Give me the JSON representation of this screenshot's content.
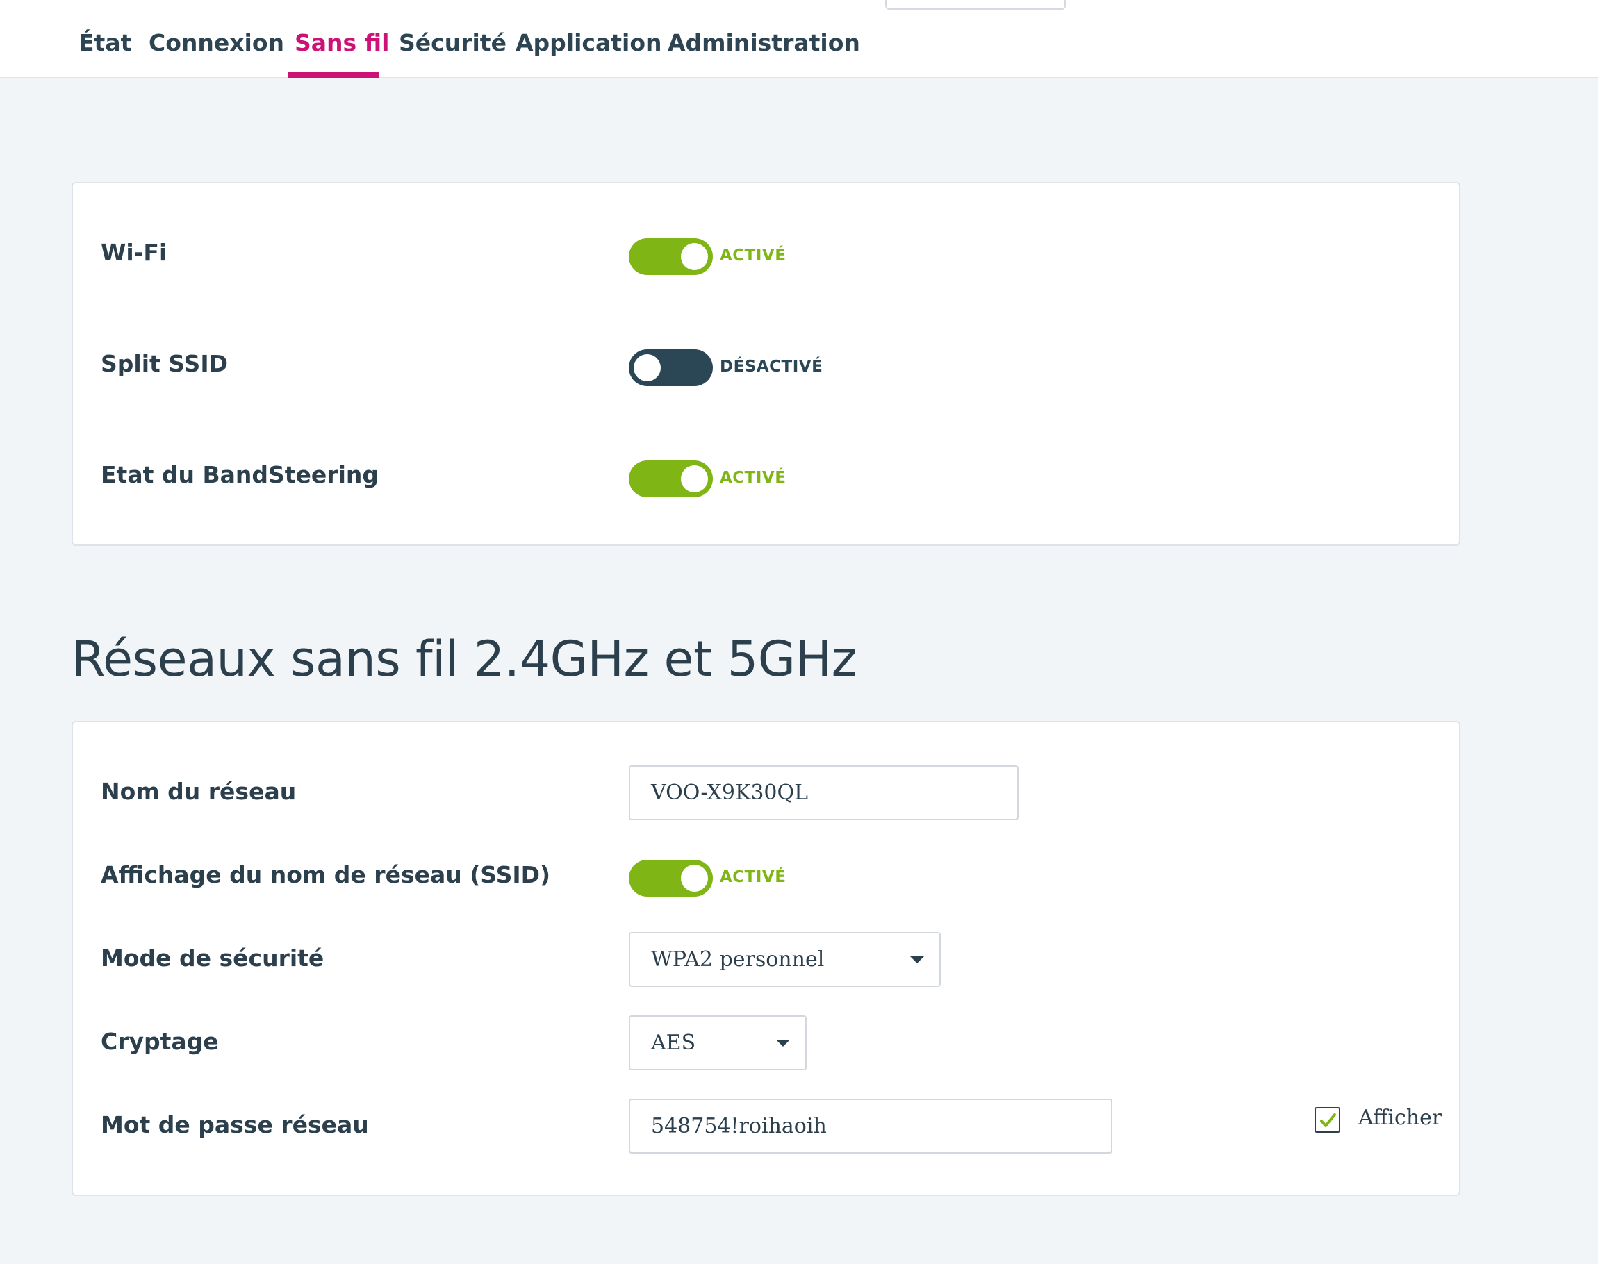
{
  "nav": {
    "tabs": [
      {
        "label": "État"
      },
      {
        "label": "Connexion"
      },
      {
        "label": "Sans fil"
      },
      {
        "label": "Sécurité"
      },
      {
        "label": "Application"
      },
      {
        "label": "Administration"
      }
    ],
    "active_tab": "Sans fil"
  },
  "general": {
    "wifi": {
      "label": "Wi-Fi",
      "state": "ACTIVÉ",
      "enabled": true
    },
    "split_ssid": {
      "label": "Split SSID",
      "state": "DÉSACTIVÉ",
      "enabled": false
    },
    "bandsteering": {
      "label": "Etat du BandSteering",
      "state": "ACTIVÉ",
      "enabled": true
    }
  },
  "networks": {
    "title": "Réseaux sans fil 2.4GHz et 5GHz",
    "network_name": {
      "label": "Nom du réseau",
      "value": "VOO-X9K30QL"
    },
    "ssid_display": {
      "label": "Affichage du nom de réseau (SSID)",
      "state": "ACTIVÉ",
      "enabled": true
    },
    "security_mode": {
      "label": "Mode de sécurité",
      "value": "WPA2 personnel"
    },
    "encryption": {
      "label": "Cryptage",
      "value": "AES"
    },
    "password": {
      "label": "Mot de passe réseau",
      "value": "548754!roihaoih",
      "show_label": "Afficher",
      "show_checked": true
    }
  },
  "colors": {
    "accent": "#cc1276",
    "toggle_on": "#7fb616",
    "toggle_off": "#2b4654",
    "text": "#2b3f4c",
    "background": "#f2f5f8"
  }
}
